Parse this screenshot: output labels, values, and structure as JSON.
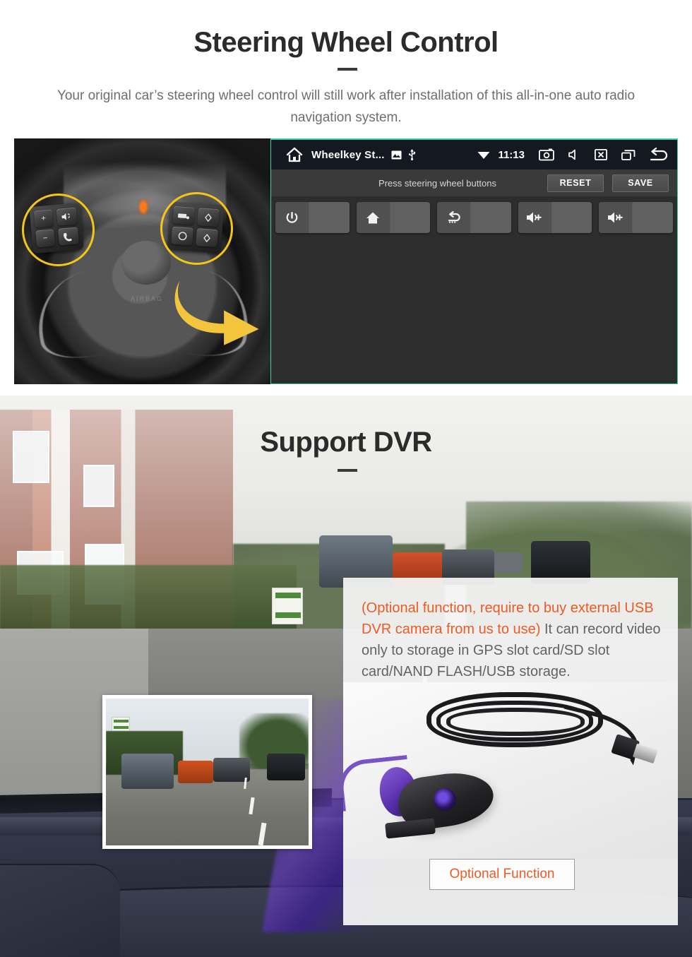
{
  "section1": {
    "title": "Steering Wheel Control",
    "subtitle": "Your original car’s steering wheel control will still work after installation of this all-in-one auto radio navigation system.",
    "steering_wheel_photo": {
      "alt": "steering-wheel-photo",
      "left_pad_keys": [
        "+",
        "−",
        "voice-command",
        "phone-call"
      ],
      "right_pad_keys": [
        "media-source",
        "up-arrow",
        "mode-circle",
        "down-arrow"
      ],
      "highlight_color": "#F5C518",
      "arrow_color": "#F2C53D"
    },
    "head_unit": {
      "border_color": "#3fd0ac",
      "status_bar": {
        "home_icon": "home-outline-icon",
        "app_title": "Wheelkey St...",
        "image_icon": "image-icon",
        "usb_icon": "usb-icon",
        "wifi_icon": "wifi-icon",
        "clock": "11:13",
        "screenshot_icon": "screenshot-camera-icon",
        "mute_icon": "volume-mute-icon",
        "screen_off_icon": "screen-off-icon",
        "recents_icon": "recent-apps-icon",
        "back_icon": "back-arrow-icon"
      },
      "toolbar": {
        "hint": "Press steering wheel buttons",
        "reset_label": "RESET",
        "save_label": "SAVE"
      },
      "keys": [
        {
          "icon": "power-icon",
          "glyph": "⏻",
          "value": ""
        },
        {
          "icon": "home-icon",
          "glyph": "⌂",
          "value": ""
        },
        {
          "icon": "back-icon",
          "glyph": "↩",
          "value": ""
        },
        {
          "icon": "volume-up-icon",
          "glyph": "🔊+",
          "value": ""
        },
        {
          "icon": "volume-up-icon",
          "glyph": "🔊+",
          "value": ""
        }
      ]
    }
  },
  "section2": {
    "title": "Support DVR",
    "panel": {
      "note_orange": "(Optional function, require to buy external USB DVR camera from us to use)",
      "note_grey": "It can record video only to storage in GPS slot card/SD slot card/NAND FLASH/USB storage.",
      "button_label": "Optional Function",
      "note_orange_color": "#ef5a24",
      "note_grey_color": "#636363"
    },
    "dvr_preview_alt": "dvr-recorded-video-preview",
    "product_alt": "usb-dvr-camera-product-photo"
  }
}
